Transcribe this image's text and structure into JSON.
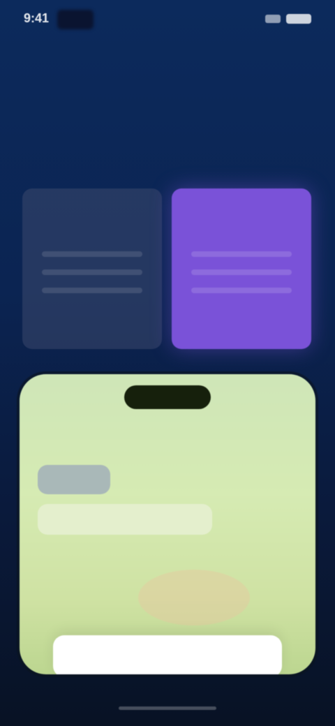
{
  "status_bar": {
    "time": "9:41",
    "icons": [
      "signal-icon",
      "battery-icon"
    ]
  },
  "top_link": "",
  "hero": {
    "title": "",
    "subtitle": ""
  },
  "plans": [
    {
      "label": ""
    },
    {
      "label": ""
    }
  ],
  "preview": {
    "header": "",
    "message": "",
    "reply": ""
  },
  "cta": {
    "label": ""
  },
  "colors": {
    "background_top": "#0c2a5c",
    "background_bottom": "#081224",
    "accent_plan": "#7a52d8",
    "preview_green": "#d6ebb3"
  }
}
